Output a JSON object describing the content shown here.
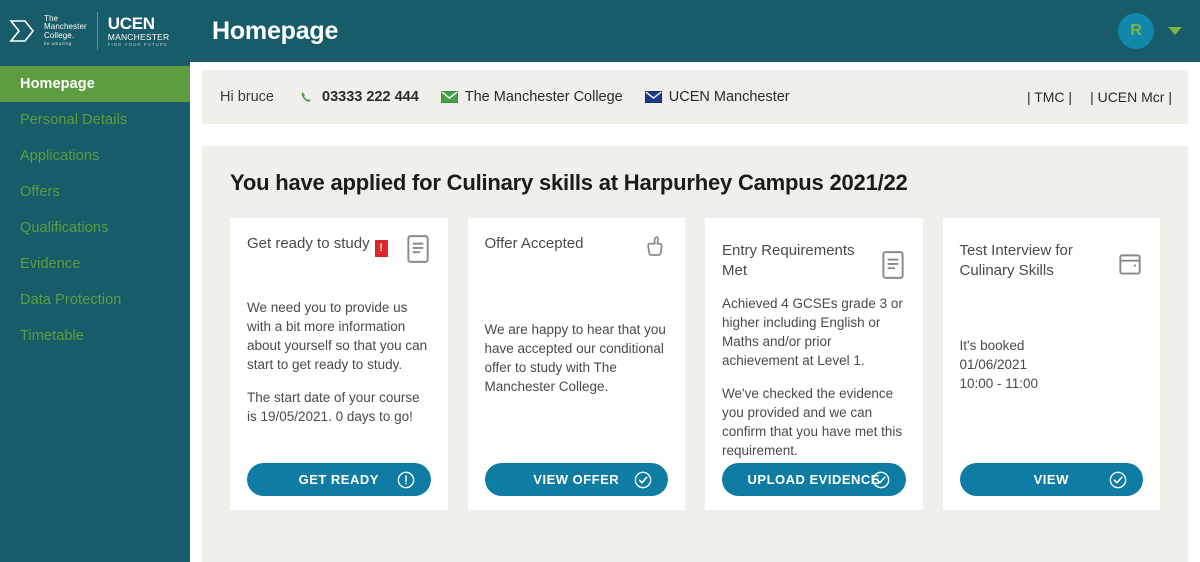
{
  "header": {
    "title": "Homepage",
    "logo_tmc": {
      "line1": "The",
      "line2": "Manchester",
      "line3": "College.",
      "tagline": "be amazing"
    },
    "logo_ucen": {
      "line1": "UCEN",
      "line2": "MANCHESTER",
      "tagline": "FIND YOUR FUTURE"
    },
    "avatar_initial": "R",
    "caret_icon": "chevron-down-icon"
  },
  "sidebar": {
    "items": [
      {
        "label": "Homepage",
        "active": true
      },
      {
        "label": "Personal Details",
        "active": false
      },
      {
        "label": "Applications",
        "active": false
      },
      {
        "label": "Offers",
        "active": false
      },
      {
        "label": "Qualifications",
        "active": false
      },
      {
        "label": "Evidence",
        "active": false
      },
      {
        "label": "Data Protection",
        "active": false
      },
      {
        "label": "Timetable",
        "active": false
      }
    ]
  },
  "infobar": {
    "greeting": "Hi bruce",
    "phone": "03333 222 444",
    "phone_icon": "phone-icon",
    "email_tmc": "The Manchester College",
    "email_tmc_icon": "envelope-icon",
    "email_ucen": "UCEN Manchester",
    "email_ucen_icon": "envelope-icon",
    "link_tmc": "| TMC |",
    "link_ucen": "| UCEN Mcr |"
  },
  "main": {
    "heading": "You have applied for Culinary skills at Harpurhey Campus 2021/22",
    "cards": [
      {
        "title": "Get ready to study",
        "badge": "!",
        "icon": "document-icon",
        "paragraphs": [
          "We need you to provide us with a bit more information about yourself so that you can start to get ready to study.",
          "The start date of your course is 19/05/2021. 0 days to go!"
        ],
        "button_label": "GET READY",
        "button_icon": "exclamation-circle-icon"
      },
      {
        "title": "Offer Accepted",
        "badge": "",
        "icon": "thumbs-up-icon",
        "paragraphs": [
          "We are happy to hear that you have accepted our conditional offer to study with The Manchester College."
        ],
        "button_label": "VIEW OFFER",
        "button_icon": "check-circle-icon"
      },
      {
        "title": "Entry Requirements Met",
        "badge": "",
        "icon": "document-icon",
        "paragraphs": [
          "Achieved 4 GCSEs grade 3 or higher including English or Maths and/or prior achievement at Level 1.",
          "We've checked the evidence you provided and we can confirm that you have met this requirement."
        ],
        "button_label": "UPLOAD EVIDENCE",
        "button_icon": "check-circle-icon"
      },
      {
        "title": "Test Interview for Culinary Skills",
        "badge": "",
        "icon": "calendar-icon",
        "paragraphs": [
          "It's booked\n01/06/2021\n10:00 - 11:00"
        ],
        "button_label": "VIEW",
        "button_icon": "check-circle-icon"
      }
    ]
  },
  "colors": {
    "teal": "#175C68",
    "green": "#5E9D3F",
    "blue_button": "#0F7CA3",
    "cream": "#F1EFE9",
    "red_badge": "#E0262B",
    "avatar_bg": "#1287AC"
  }
}
